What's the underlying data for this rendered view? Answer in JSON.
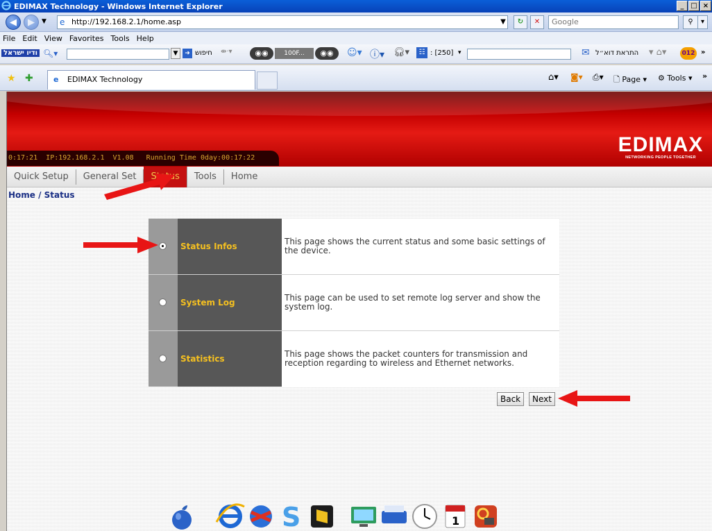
{
  "window": {
    "title": "EDIMAX Technology - Windows Internet Explorer",
    "controls": [
      "_",
      "□",
      "×"
    ]
  },
  "addressbar": {
    "url": "http://192.168.2.1/home.asp",
    "search_placeholder": "Google"
  },
  "menu": [
    "File",
    "Edit",
    "View",
    "Favorites",
    "Tools",
    "Help"
  ],
  "toolbar2": {
    "logo_text": "ודיו ישראל",
    "search_label": "חיפוש",
    "zoom_text": "100F...",
    "count_text": ": [250]",
    "alerts_label": "התראת דוא״ל",
    "brand_badge": "012"
  },
  "favbar": {
    "tab_title": "EDIMAX Technology",
    "page_menu": "Page",
    "tools_menu": "Tools"
  },
  "header": {
    "status_line": "0:17:21  IP:192.168.2.1  V1.08   Running Time 0day:00:17:22",
    "logo": "EDIMAX",
    "tagline": "NETWORKING PEOPLE TOGETHER"
  },
  "nav": {
    "items": [
      "Quick Setup",
      "General Set",
      "Status",
      "Tools",
      "Home"
    ],
    "active_index": 2
  },
  "breadcrumb": "Home / Status",
  "options": [
    {
      "label": "Status Infos",
      "description": "This page shows the current status and some basic settings of the device.",
      "selected": true
    },
    {
      "label": "System Log",
      "description": "This page can be used to set remote log server and show the system log.",
      "selected": false
    },
    {
      "label": "Statistics",
      "description": "This page shows the packet counters for transmission and reception regarding to wireless and Ethernet networks.",
      "selected": false
    }
  ],
  "buttons": {
    "back": "Back",
    "next": "Next"
  },
  "colors": {
    "header_red": "#e51b14",
    "nav_active": "#c41010",
    "label_gold": "#f5c020",
    "breadcrumb_blue": "#1a2f85",
    "annotation_arrow": "#e81515"
  }
}
